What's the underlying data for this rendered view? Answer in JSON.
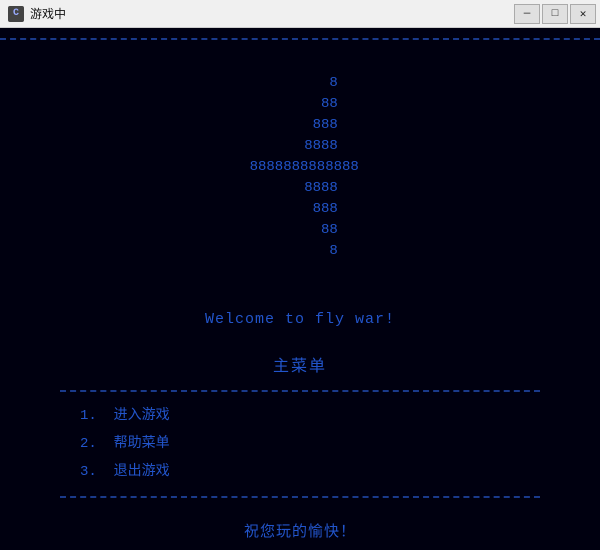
{
  "titlebar": {
    "title": "游戏中",
    "icon": "C",
    "minimize_label": "—",
    "restore_label": "□",
    "close_label": "✕"
  },
  "ascii_art": {
    "lines": [
      "        8",
      "       88",
      "      888",
      "     8888",
      " 8888888888888",
      "     8888",
      "      888",
      "       88",
      "        8"
    ]
  },
  "welcome": {
    "text": "Welcome to fly war!"
  },
  "menu": {
    "title": "主菜单",
    "items": [
      {
        "number": "1.",
        "label": "进入游戏"
      },
      {
        "number": "2.",
        "label": "帮助菜单"
      },
      {
        "number": "3.",
        "label": "退出游戏"
      }
    ]
  },
  "footer": {
    "text": "祝您玩的愉快！"
  }
}
